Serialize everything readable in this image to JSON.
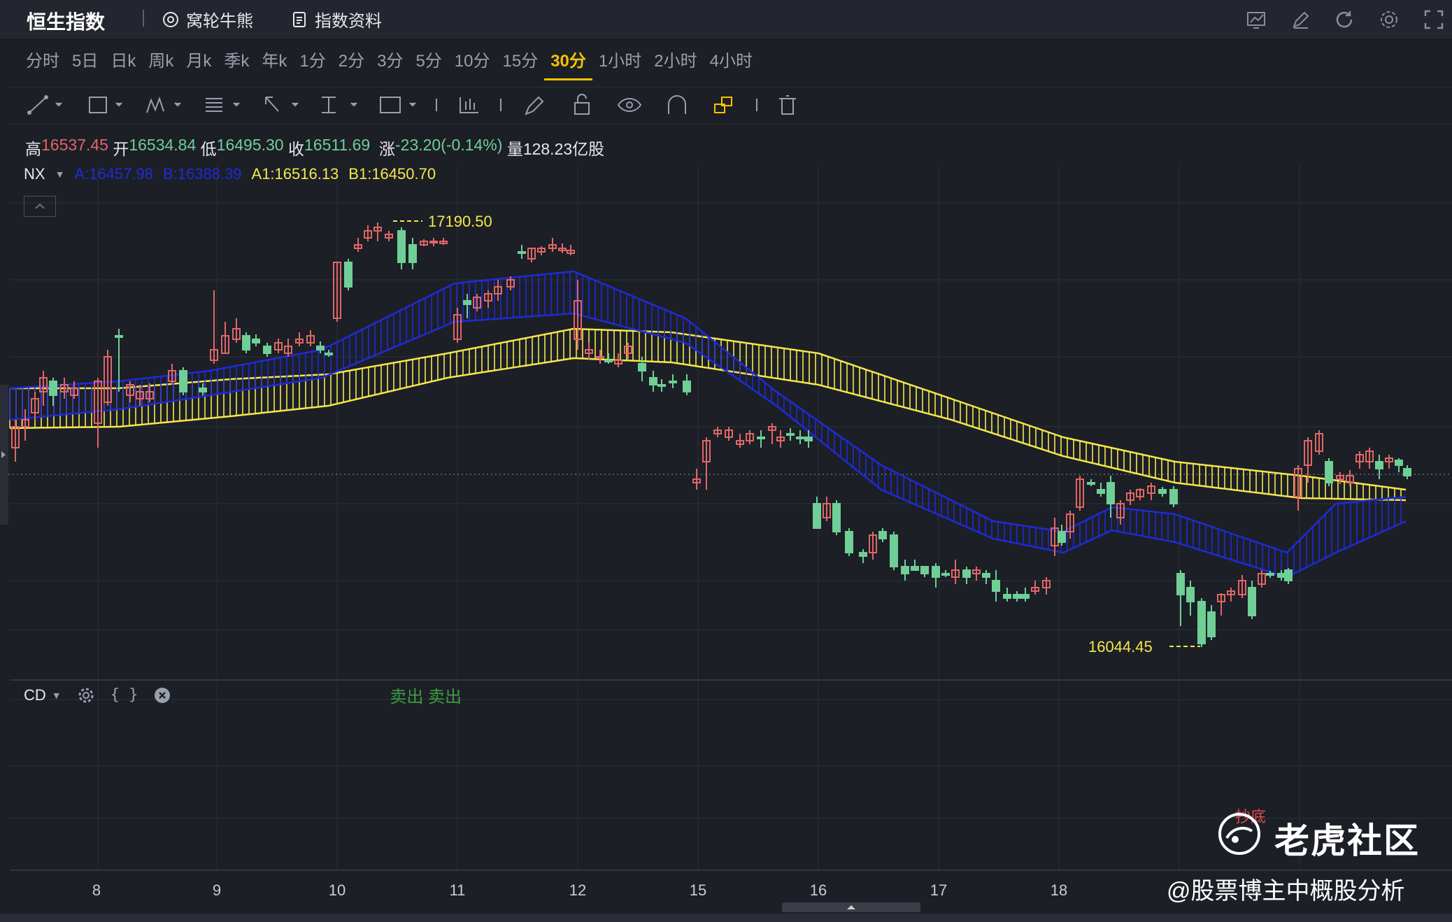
{
  "header": {
    "title": "恒生指数",
    "warrant_label": "窝轮牛熊",
    "index_info_label": "指数资料",
    "right_icons": [
      "chart-icon",
      "draw-icon",
      "refresh-icon",
      "settings-icon",
      "fullscreen-icon"
    ]
  },
  "periods": {
    "items": [
      "分时",
      "5日",
      "日k",
      "周k",
      "月k",
      "季k",
      "年k",
      "1分",
      "2分",
      "3分",
      "5分",
      "10分",
      "15分",
      "30分",
      "1小时",
      "2小时",
      "4小时"
    ],
    "active": "30分"
  },
  "toolbar": {
    "icons": [
      "trendline-icon",
      "rectangle-icon",
      "pattern-icon",
      "fib-icon",
      "arrow-icon",
      "measure-icon",
      "text-icon",
      "bars-icon",
      "pencil-icon",
      "lock-icon",
      "eye-icon",
      "magnet-icon",
      "link-icon",
      "trash-icon"
    ]
  },
  "ohlc": {
    "high_label": "高",
    "high": "16537.45",
    "open_label": "开",
    "open": "16534.84",
    "low_label": "低",
    "low": "16495.30",
    "close_label": "收",
    "close": "16511.69",
    "change_label": "涨",
    "change": "-23.20(-0.14%)",
    "volume_label": "量",
    "volume": "128.23亿股"
  },
  "indicator": {
    "name": "NX",
    "a": "A:16457.98",
    "b": "B:16388.39",
    "a1": "A1:16516.13",
    "b1": "B1:16450.70"
  },
  "sub_indicator": {
    "name": "CD",
    "signals": "卖出 卖出"
  },
  "chart_data": {
    "type": "candlestick",
    "x_ticks": [
      "8",
      "9",
      "10",
      "11",
      "12",
      "15",
      "16",
      "17",
      "18"
    ],
    "high_marker": "17190.50",
    "low_marker": "16044.45",
    "colors": {
      "up": "#e06666",
      "down": "#6fcf97",
      "band_yellow": "#f5e84a",
      "band_blue": "#1f2bd6"
    },
    "annotation": "抄底"
  },
  "watermark": {
    "brand": "老虎社区",
    "author": "@股票博主中概股分析"
  }
}
